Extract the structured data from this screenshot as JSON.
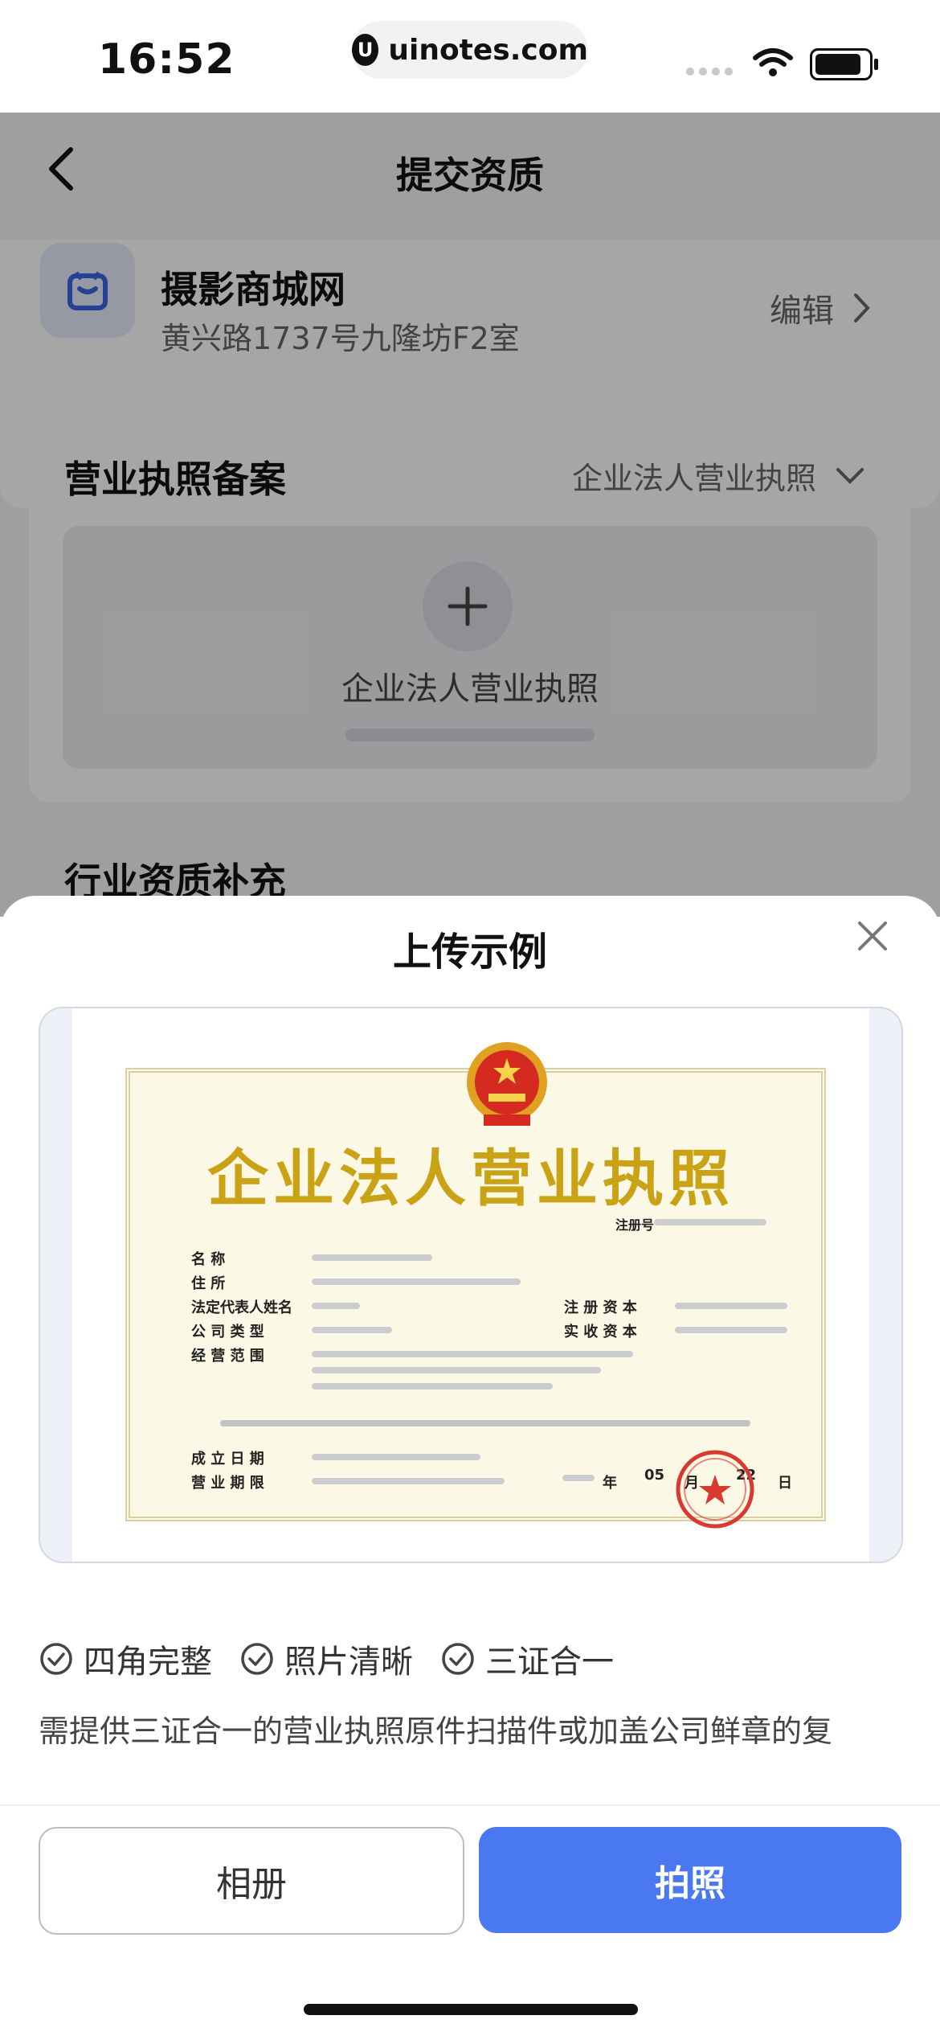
{
  "status_bar": {
    "time": "16:52",
    "url": "uinotes.com",
    "icons": [
      "signal-icon",
      "wifi-icon",
      "battery-icon"
    ]
  },
  "nav": {
    "title": "提交资质",
    "back_icon": "chevron-left-icon"
  },
  "store": {
    "name": "摄影商城网",
    "address": "黄兴路1737号九隆坊F2室",
    "edit_label": "编辑"
  },
  "license": {
    "section_title": "营业执照备案",
    "selected_type": "企业法人营业执照",
    "upload_label": "企业法人营业执照"
  },
  "industry": {
    "section_title": "行业资质补充"
  },
  "sheet": {
    "title": "上传示例",
    "certificate": {
      "title": "企业法人营业执照",
      "reg_label": "注册号",
      "fields": [
        "名      称",
        "住      所",
        "法定代表人姓名",
        "公 司 类 型",
        "经 营 范 围",
        "成 立 日 期",
        "营 业 期 限"
      ],
      "right_fields": [
        "注 册 资 本",
        "实 收 资 本"
      ],
      "date_labels": [
        "年",
        "05",
        "月",
        "22",
        "日"
      ]
    },
    "tags": [
      "四角完整",
      "照片清晰",
      "三证合一"
    ],
    "description": "需提供三证合一的营业执照原件扫描件或加盖公司鲜章的复",
    "buttons": {
      "album": "相册",
      "photo": "拍照"
    }
  },
  "colors": {
    "primary": "#4a78f0",
    "certificate_gold": "#c9a216"
  }
}
